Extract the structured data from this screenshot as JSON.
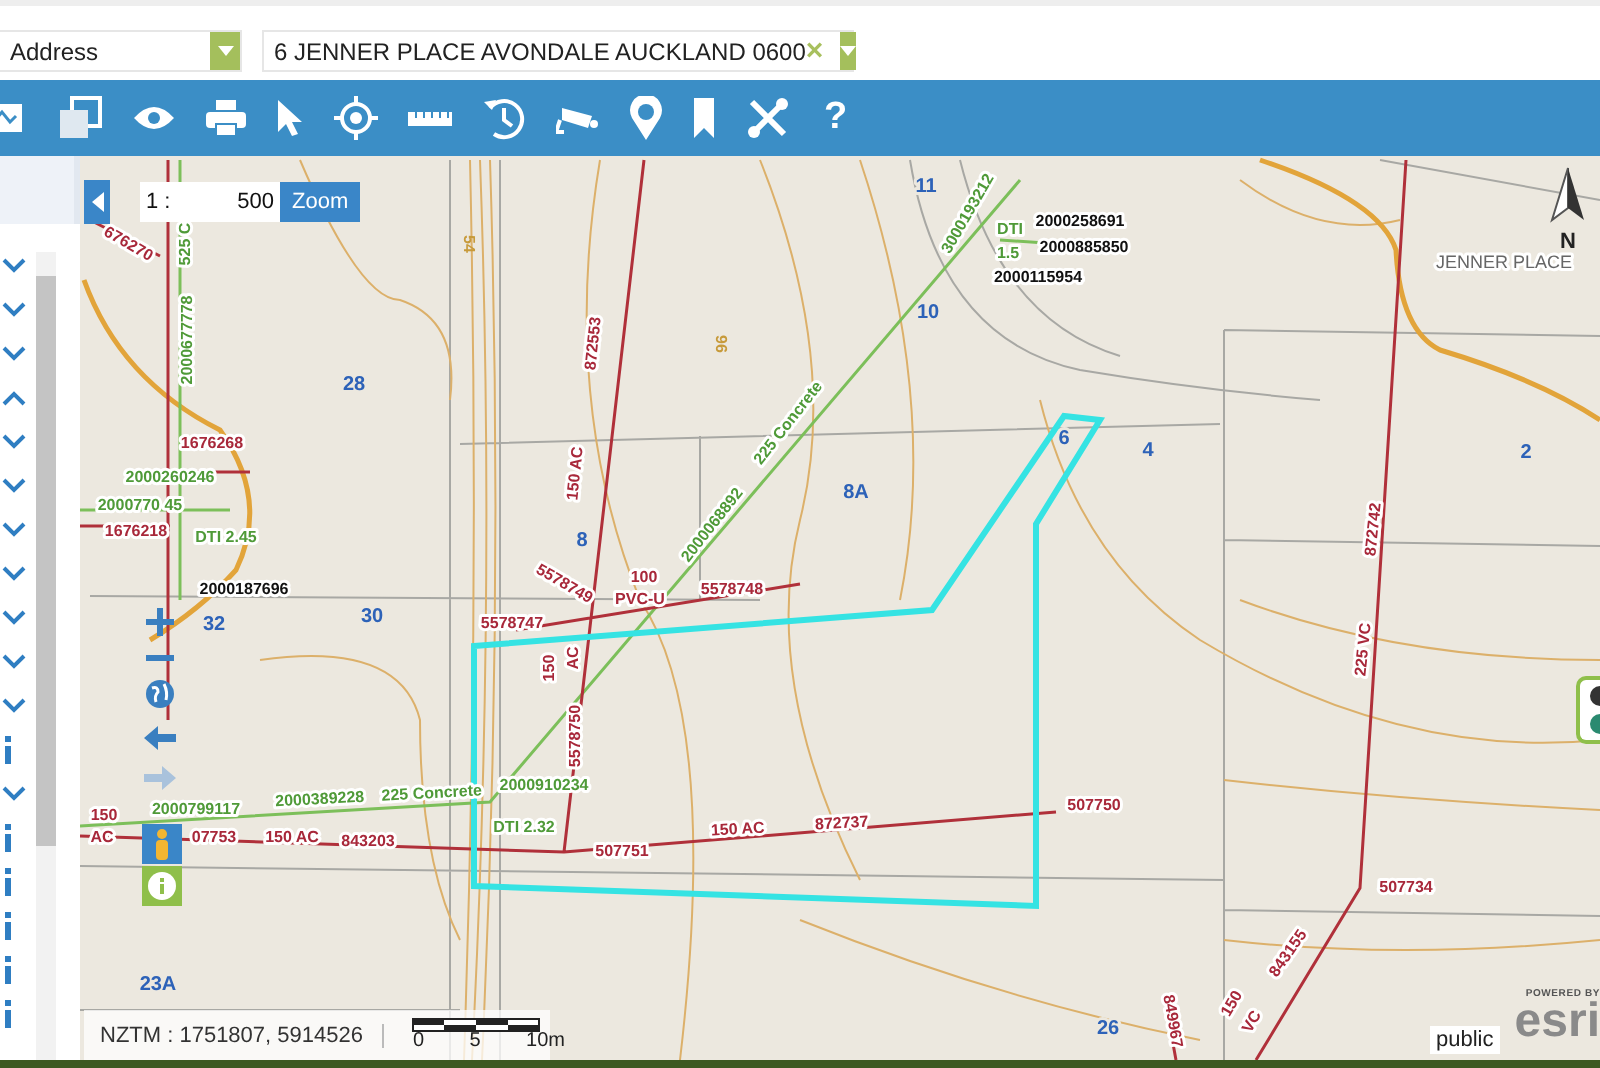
{
  "search": {
    "type_value": "Address",
    "address_value": "6 JENNER PLACE AVONDALE AUCKLAND 0600",
    "clear": "×"
  },
  "toolbar": {
    "help_label": "?"
  },
  "layers": [
    {
      "kind": "toggle",
      "expanded": false
    },
    {
      "kind": "toggle",
      "expanded": false
    },
    {
      "kind": "toggle",
      "expanded": false
    },
    {
      "kind": "toggle",
      "expanded": true
    },
    {
      "kind": "toggle",
      "expanded": false
    },
    {
      "kind": "toggle",
      "expanded": false
    },
    {
      "kind": "toggle",
      "expanded": false
    },
    {
      "kind": "toggle",
      "expanded": false
    },
    {
      "kind": "toggle",
      "expanded": false
    },
    {
      "kind": "toggle",
      "expanded": false
    },
    {
      "kind": "toggle",
      "expanded": false
    },
    {
      "kind": "info"
    },
    {
      "kind": "toggle",
      "expanded": false
    },
    {
      "kind": "info"
    },
    {
      "kind": "info"
    },
    {
      "kind": "info"
    },
    {
      "kind": "info"
    },
    {
      "kind": "info"
    }
  ],
  "scale": {
    "prefix": "1 :",
    "value": "500",
    "button": "Zoom"
  },
  "map_labels": [
    {
      "text": "11",
      "kind": "parcel"
    },
    {
      "text": "3000193212",
      "kind": "storm"
    },
    {
      "text": "2000258691",
      "kind": "node"
    },
    {
      "text": "DTI",
      "kind": "storm"
    },
    {
      "text": "54",
      "kind": "contour"
    },
    {
      "text": "525 C",
      "kind": "storm"
    },
    {
      "text": "676270",
      "kind": "sewer"
    },
    {
      "text": "2000885850",
      "kind": "node"
    },
    {
      "text": "1.5",
      "kind": "storm"
    },
    {
      "text": "JENNER PLACE",
      "kind": "street"
    },
    {
      "text": "2000115954",
      "kind": "node"
    },
    {
      "text": "10",
      "kind": "parcel"
    },
    {
      "text": "2000677778",
      "kind": "storm"
    },
    {
      "text": "96",
      "kind": "contour"
    },
    {
      "text": "872553",
      "kind": "sewer"
    },
    {
      "text": "28",
      "kind": "parcel"
    },
    {
      "text": "225 Concrete",
      "kind": "storm"
    },
    {
      "text": "6",
      "kind": "parcel"
    },
    {
      "text": "1676268",
      "kind": "sewer"
    },
    {
      "text": "4",
      "kind": "parcel"
    },
    {
      "text": "2",
      "kind": "parcel"
    },
    {
      "text": "150 AC",
      "kind": "sewer"
    },
    {
      "text": "2000260246",
      "kind": "storm"
    },
    {
      "text": "8A",
      "kind": "parcel"
    },
    {
      "text": "2000770 45",
      "kind": "storm"
    },
    {
      "text": "2000068892",
      "kind": "storm"
    },
    {
      "text": "872742",
      "kind": "sewer"
    },
    {
      "text": "1676218",
      "kind": "sewer"
    },
    {
      "text": "DTI 2.45",
      "kind": "storm"
    },
    {
      "text": "8",
      "kind": "parcel"
    },
    {
      "text": "100",
      "kind": "sewer"
    },
    {
      "text": "5578749",
      "kind": "sewer"
    },
    {
      "text": "5578748",
      "kind": "sewer"
    },
    {
      "text": "2000187696",
      "kind": "node"
    },
    {
      "text": "PVC-U",
      "kind": "sewer"
    },
    {
      "text": "30",
      "kind": "parcel"
    },
    {
      "text": "32",
      "kind": "parcel"
    },
    {
      "text": "5578747",
      "kind": "sewer"
    },
    {
      "text": "225 VC",
      "kind": "sewer"
    },
    {
      "text": "AC",
      "kind": "sewer"
    },
    {
      "text": "150",
      "kind": "sewer"
    },
    {
      "text": "5578750",
      "kind": "sewer"
    },
    {
      "text": "2000910234",
      "kind": "storm"
    },
    {
      "text": "225 Concrete",
      "kind": "storm"
    },
    {
      "text": "2000389228",
      "kind": "storm"
    },
    {
      "text": "507750",
      "kind": "sewer"
    },
    {
      "text": "2000799117",
      "kind": "storm"
    },
    {
      "text": "150",
      "kind": "sewer"
    },
    {
      "text": "150 AC",
      "kind": "sewer"
    },
    {
      "text": "872737",
      "kind": "sewer"
    },
    {
      "text": "DTI 2.32",
      "kind": "storm"
    },
    {
      "text": "AC",
      "kind": "sewer"
    },
    {
      "text": "07753",
      "kind": "sewer"
    },
    {
      "text": "150 AC",
      "kind": "sewer"
    },
    {
      "text": "843203",
      "kind": "sewer"
    },
    {
      "text": "507751",
      "kind": "sewer"
    },
    {
      "text": "507734",
      "kind": "sewer"
    },
    {
      "text": "843155",
      "kind": "sewer"
    },
    {
      "text": "23A",
      "kind": "parcel"
    },
    {
      "text": "150",
      "kind": "sewer"
    },
    {
      "text": "849967",
      "kind": "sewer"
    },
    {
      "text": "VC",
      "kind": "sewer"
    },
    {
      "text": "26",
      "kind": "parcel"
    }
  ],
  "north_label": "N",
  "coordinates": "NZTM : 1751807, 5914526",
  "scale_bar": [
    "0",
    "5",
    "10m"
  ],
  "attribution": "public",
  "esri": {
    "powered": "POWERED BY",
    "logo": "esri"
  }
}
